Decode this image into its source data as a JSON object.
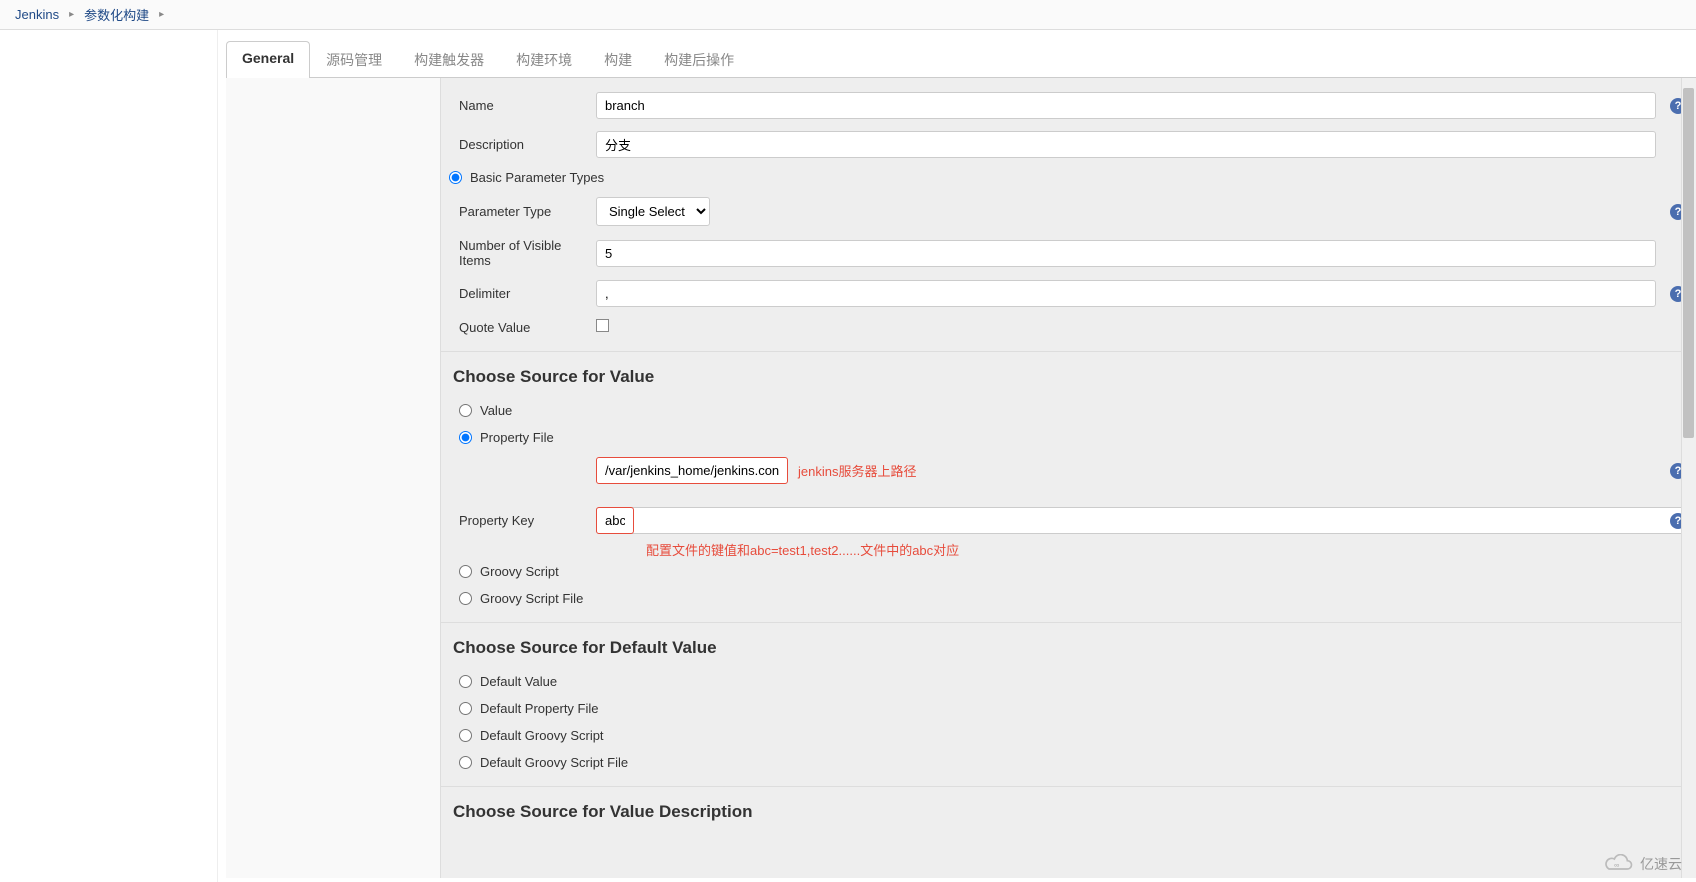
{
  "breadcrumb": {
    "home": "Jenkins",
    "job": "参数化构建"
  },
  "tabs": {
    "general": "General",
    "scm": "源码管理",
    "triggers": "构建触发器",
    "env": "构建环境",
    "build": "构建",
    "post": "构建后操作"
  },
  "form": {
    "name_label": "Name",
    "name_value": "branch",
    "desc_label": "Description",
    "desc_value": "分支",
    "basic_types_label": "Basic Parameter Types",
    "param_type_label": "Parameter Type",
    "param_type_value": "Single Select",
    "visible_items_label": "Number of Visible Items",
    "visible_items_value": "5",
    "delimiter_label": "Delimiter",
    "delimiter_value": ",",
    "quote_label": "Quote Value"
  },
  "source_value": {
    "heading": "Choose Source for Value",
    "opt_value": "Value",
    "opt_property_file": "Property File",
    "property_file_value": "/var/jenkins_home/jenkins.conf",
    "property_key_label": "Property Key",
    "property_key_value": "abc",
    "opt_groovy": "Groovy Script",
    "opt_groovy_file": "Groovy Script File"
  },
  "source_default": {
    "heading": "Choose Source for Default Value",
    "opt_default_value": "Default Value",
    "opt_default_file": "Default Property File",
    "opt_default_groovy": "Default Groovy Script",
    "opt_default_groovy_file": "Default Groovy Script File"
  },
  "source_desc": {
    "heading": "Choose Source for Value Description"
  },
  "annotations": {
    "server_path": "jenkins服务器上路径",
    "config_key": "配置文件的键值和abc=test1,test2......文件中的abc对应"
  },
  "watermark": "亿速云"
}
